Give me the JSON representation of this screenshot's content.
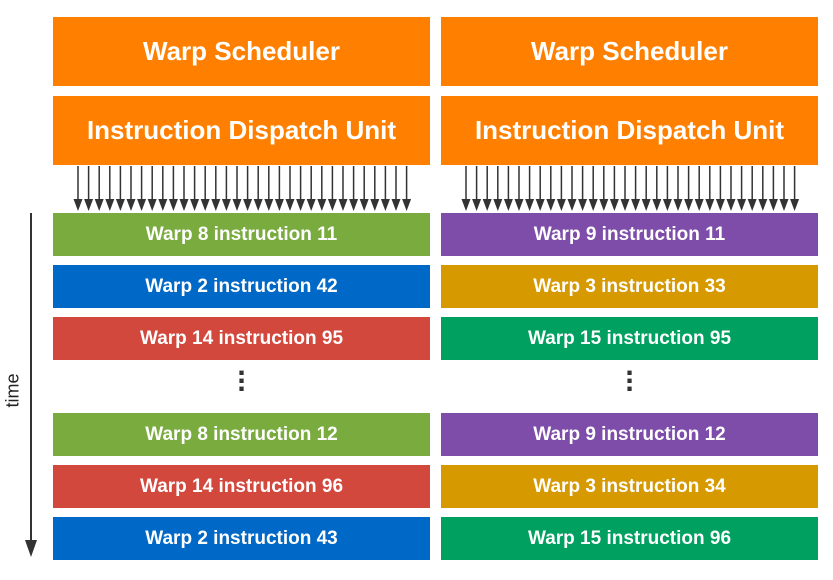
{
  "columns": [
    {
      "scheduler": "Warp Scheduler",
      "dispatch": "Instruction Dispatch Unit",
      "top_rows": [
        {
          "label": "Warp 8 instruction 11",
          "color": "#7AAB3F"
        },
        {
          "label": "Warp 2 instruction 42",
          "color": "#0068C6"
        },
        {
          "label": "Warp 14 instruction 95",
          "color": "#D2483D"
        }
      ],
      "bottom_rows": [
        {
          "label": "Warp 8 instruction 12",
          "color": "#7AAB3F"
        },
        {
          "label": "Warp 14 instruction 96",
          "color": "#D2483D"
        },
        {
          "label": "Warp 2 instruction 43",
          "color": "#0068C6"
        }
      ]
    },
    {
      "scheduler": "Warp Scheduler",
      "dispatch": "Instruction Dispatch Unit",
      "top_rows": [
        {
          "label": "Warp 9 instruction 11",
          "color": "#7E4DAA"
        },
        {
          "label": "Warp 3 instruction 33",
          "color": "#D69A00"
        },
        {
          "label": "Warp 15 instruction 95",
          "color": "#00A060"
        }
      ],
      "bottom_rows": [
        {
          "label": "Warp 9 instruction 12",
          "color": "#7E4DAA"
        },
        {
          "label": "Warp 3 instruction 34",
          "color": "#D69A00"
        },
        {
          "label": "Warp 15 instruction 96",
          "color": "#00A060"
        }
      ]
    }
  ],
  "time_label": "time",
  "colors": {
    "unit": "#FF8000",
    "arrow": "#333333"
  }
}
